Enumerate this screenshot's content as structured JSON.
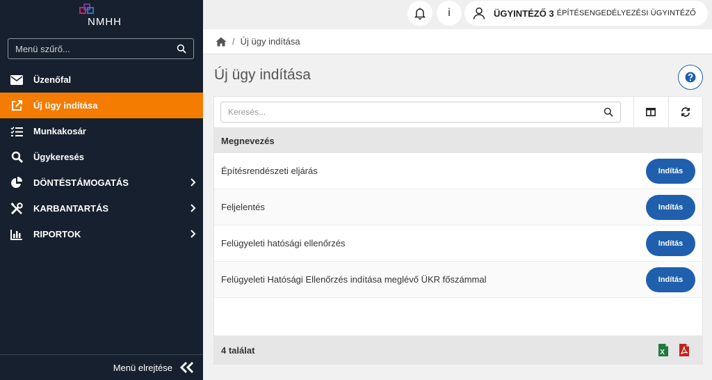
{
  "sidebar": {
    "logo_text": "NMHH",
    "filter_placeholder": "Menü szűrő...",
    "items": [
      {
        "label": "Üzenőfal",
        "icon": "envelope-icon"
      },
      {
        "label": "Új ügy indítása",
        "icon": "external-edit-icon",
        "active": true
      },
      {
        "label": "Munkakosár",
        "icon": "checklist-icon"
      },
      {
        "label": "Ügykeresés",
        "icon": "search-icon"
      },
      {
        "label": "DÖNTÉSTÁMOGATÁS",
        "icon": "pie-chart-icon",
        "expandable": true
      },
      {
        "label": "KARBANTARTÁS",
        "icon": "tools-icon",
        "expandable": true
      },
      {
        "label": "RIPORTOK",
        "icon": "bar-chart-icon",
        "expandable": true
      }
    ],
    "collapse_label": "Menü elrejtése"
  },
  "topbar": {
    "info_label": "i",
    "user_role": "ÜGYINTÉZŐ 3",
    "user_dept": "ÉPÍTÉSENGEDÉLYEZÉSI ÜGYINTÉZŐ"
  },
  "breadcrumb": {
    "current": "Új ügy indítása"
  },
  "page": {
    "title": "Új ügy indítása"
  },
  "table": {
    "search_placeholder": "Keresés...",
    "column_header": "Megnevezés",
    "rows": [
      {
        "name": "Építésrendészeti eljárás",
        "action": "Indítás"
      },
      {
        "name": "Feljelentés",
        "action": "Indítás"
      },
      {
        "name": "Felügyeleti hatósági ellenőrzés",
        "action": "Indítás"
      },
      {
        "name": "Felügyeleti Hatósági Ellenőrzés indítása meglévő ÜKR főszámmal",
        "action": "Indítás"
      }
    ],
    "result_count": "4 találat"
  },
  "colors": {
    "sidebar_bg": "#17202e",
    "active_item": "#f47c00",
    "primary_button": "#1f5fad",
    "excel_green": "#1e7a3c",
    "pdf_red": "#c0231f"
  }
}
